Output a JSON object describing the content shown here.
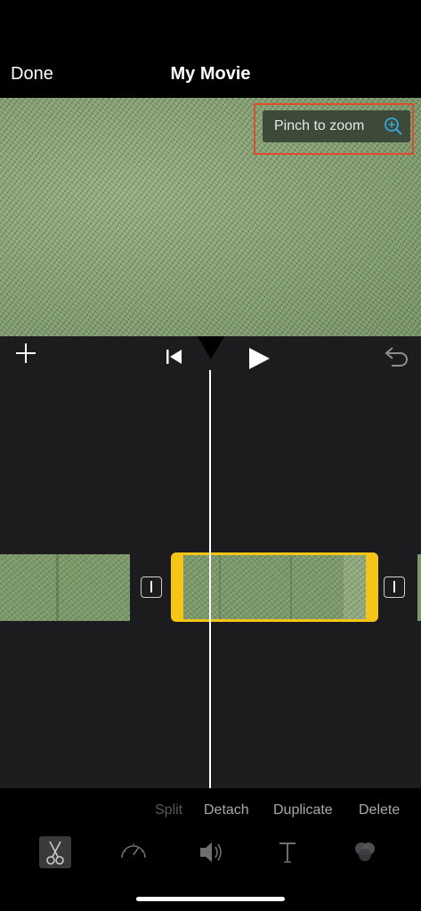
{
  "header": {
    "done_label": "Done",
    "title": "My Movie"
  },
  "preview": {
    "hint_label": "Pinch to zoom"
  },
  "actions": {
    "split": "Split",
    "detach": "Detach",
    "duplicate": "Duplicate",
    "delete": "Delete"
  },
  "colors": {
    "accent": "#f5c518",
    "highlight_outline": "#e2492d",
    "zoom_icon": "#3aa6d8"
  },
  "icons": [
    "plus-icon",
    "skip-to-start-icon",
    "play-icon",
    "undo-icon",
    "zoom-icon",
    "scissors-icon",
    "speed-icon",
    "volume-icon",
    "title-icon",
    "filters-icon"
  ]
}
